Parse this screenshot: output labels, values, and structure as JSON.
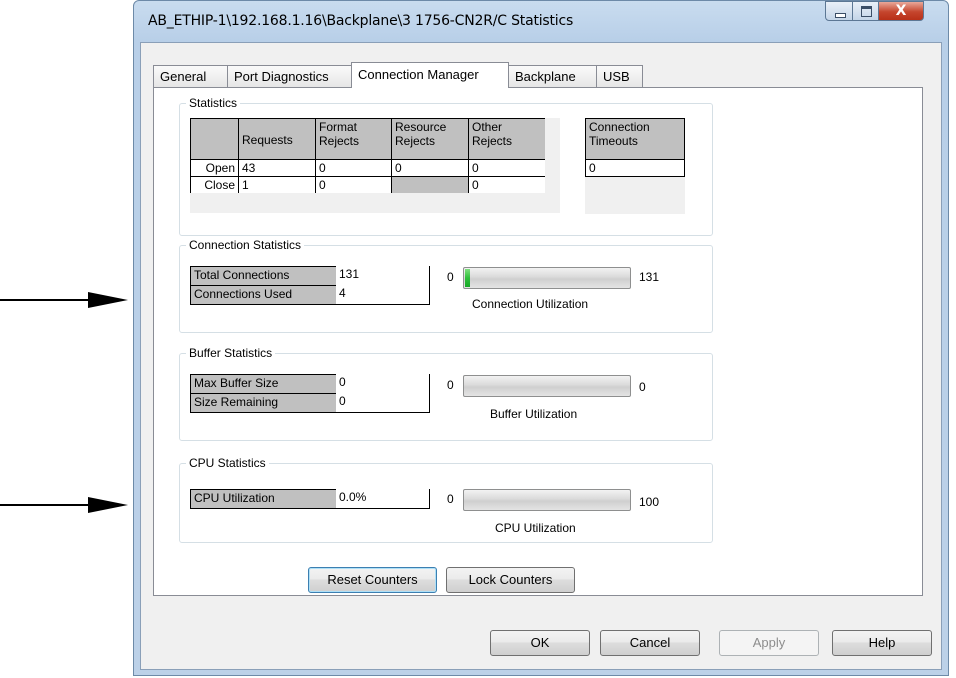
{
  "window": {
    "title": "AB_ETHIP-1\\192.168.1.16\\Backplane\\3 1756-CN2R/C Statistics",
    "close_glyph": "X"
  },
  "tabs": [
    "General",
    "Port Diagnostics",
    "Connection Manager",
    "Backplane",
    "USB"
  ],
  "active_tab": "Connection Manager",
  "statistics": {
    "title": "Statistics",
    "headers": [
      "Requests",
      "Format Rejects",
      "Resource Rejects",
      "Other Rejects"
    ],
    "rows": [
      {
        "label": "Open",
        "values": [
          "43",
          "0",
          "0",
          "0"
        ]
      },
      {
        "label": "Close",
        "values": [
          "1",
          "0",
          "",
          "0"
        ]
      }
    ],
    "timeouts_header": "Connection Timeouts",
    "timeouts_value": "0"
  },
  "connection_statistics": {
    "title": "Connection Statistics",
    "total_label": "Total Connections",
    "total_value": "131",
    "used_label": "Connections Used",
    "used_value": "4",
    "min": "0",
    "max": "131",
    "fill_fraction": 0.03,
    "caption": "Connection Utilization"
  },
  "buffer_statistics": {
    "title": "Buffer Statistics",
    "max_label": "Max Buffer Size",
    "max_value": "0",
    "remaining_label": "Size Remaining",
    "remaining_value": "0",
    "min": "0",
    "max": "0",
    "fill_fraction": 0,
    "caption": "Buffer Utilization"
  },
  "cpu_statistics": {
    "title": "CPU Statistics",
    "cpu_label": "CPU Utilization",
    "cpu_value": "0.0%",
    "min": "0",
    "max": "100",
    "fill_fraction": 0,
    "caption": "CPU Utilization"
  },
  "actions": {
    "reset": "Reset Counters",
    "lock": "Lock Counters"
  },
  "dialog_buttons": {
    "ok": "OK",
    "cancel": "Cancel",
    "apply": "Apply",
    "help": "Help"
  },
  "colors": {
    "progress_fill": "#2fbf3b",
    "header_cell": "#c0c0c0"
  }
}
